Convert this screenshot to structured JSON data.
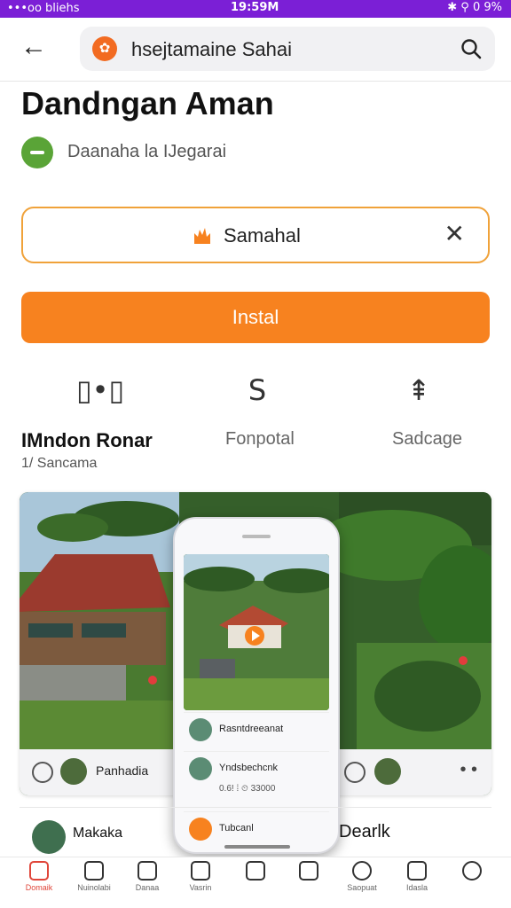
{
  "status_bar": {
    "carrier": "•••oo bliehs",
    "time": "19:59M",
    "battery": "✱ ⚲ 0 9%"
  },
  "top_bar": {
    "back_glyph": "←",
    "app_icon_glyph": "✿",
    "query": "hsejtamaine Sahai"
  },
  "app": {
    "title": "Dandngan Aman",
    "developer": "Daanaha la IJegarai"
  },
  "chip": {
    "label": "Samahal",
    "close_glyph": "✕"
  },
  "install": {
    "label": "Instal"
  },
  "stats": {
    "items": [
      {
        "icon_glyph": "▯•▯",
        "icon": "device-icon",
        "label": "IMndon Ronar"
      },
      {
        "icon_glyph": "S",
        "icon": "rating-icon",
        "label": "Fonpotal"
      },
      {
        "icon_glyph": "⇞",
        "icon": "share-icon",
        "label": "Sadcage"
      }
    ],
    "sub": "1/ Sancama"
  },
  "gallery": {
    "footer_left": "Panhadia",
    "phone_rows": [
      {
        "text": "Rasntdreeanat"
      },
      {
        "text": "Yndsbechcnk",
        "meta": "0.6! ⁞ ⏲ 33000"
      },
      {
        "text": "Tubcanl"
      }
    ]
  },
  "list": {
    "left_name": "Makaka",
    "right_name": "Dearlk"
  },
  "bottom_nav": {
    "items": [
      {
        "label": "Domaik",
        "icon": "home-icon",
        "active": true
      },
      {
        "label": "Nuinolabi",
        "icon": "clock-icon",
        "active": false
      },
      {
        "label": "Danaa",
        "icon": "star-icon",
        "active": false
      },
      {
        "label": "Vasrin",
        "icon": "leaf-icon",
        "active": false
      },
      {
        "label": "",
        "icon": "book-icon",
        "active": false
      },
      {
        "label": "",
        "icon": "apps-icon",
        "active": false
      },
      {
        "label": "Saopuat",
        "icon": "search-icon",
        "active": false
      },
      {
        "label": "Idasla",
        "icon": "calendar-icon",
        "active": false
      },
      {
        "label": "",
        "icon": "profile-icon",
        "active": false
      }
    ]
  },
  "colors": {
    "status_bar": "#7b1fd6",
    "accent_orange": "#f7821f",
    "chip_border": "#f0a23a",
    "developer_badge": "#5aa437",
    "nav_active": "#e0463a"
  }
}
